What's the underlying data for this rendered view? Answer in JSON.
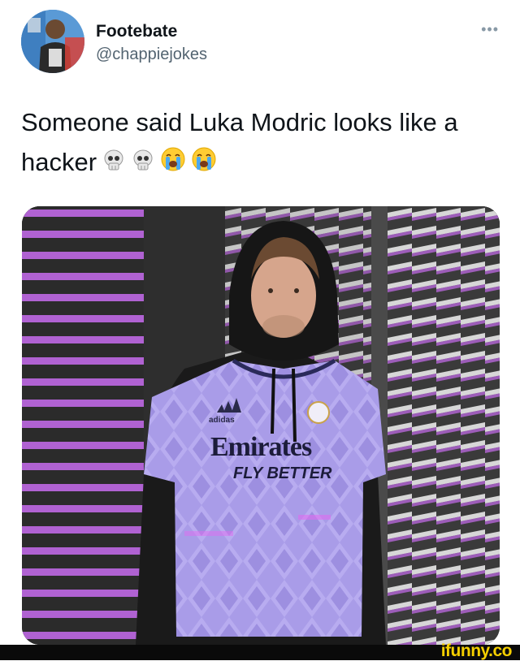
{
  "tweet": {
    "author_name": "Footebate",
    "author_handle": "@chappiejokes",
    "more_label": "•••",
    "text": "Someone said Luka Modric looks like a hacker",
    "emojis": [
      "skull-emoji",
      "skull-emoji",
      "loudly-crying-emoji",
      "loudly-crying-emoji"
    ]
  },
  "photo": {
    "jersey_brand": "adidas",
    "jersey_sponsor": "Emirates",
    "jersey_slogan": "FLY BETTER"
  },
  "watermark": {
    "label": "ifunny.co"
  },
  "colors": {
    "accent_purple": "#c86cf0",
    "jersey_lavender": "#a99ce8",
    "watermark_yellow": "#f5cf00"
  }
}
